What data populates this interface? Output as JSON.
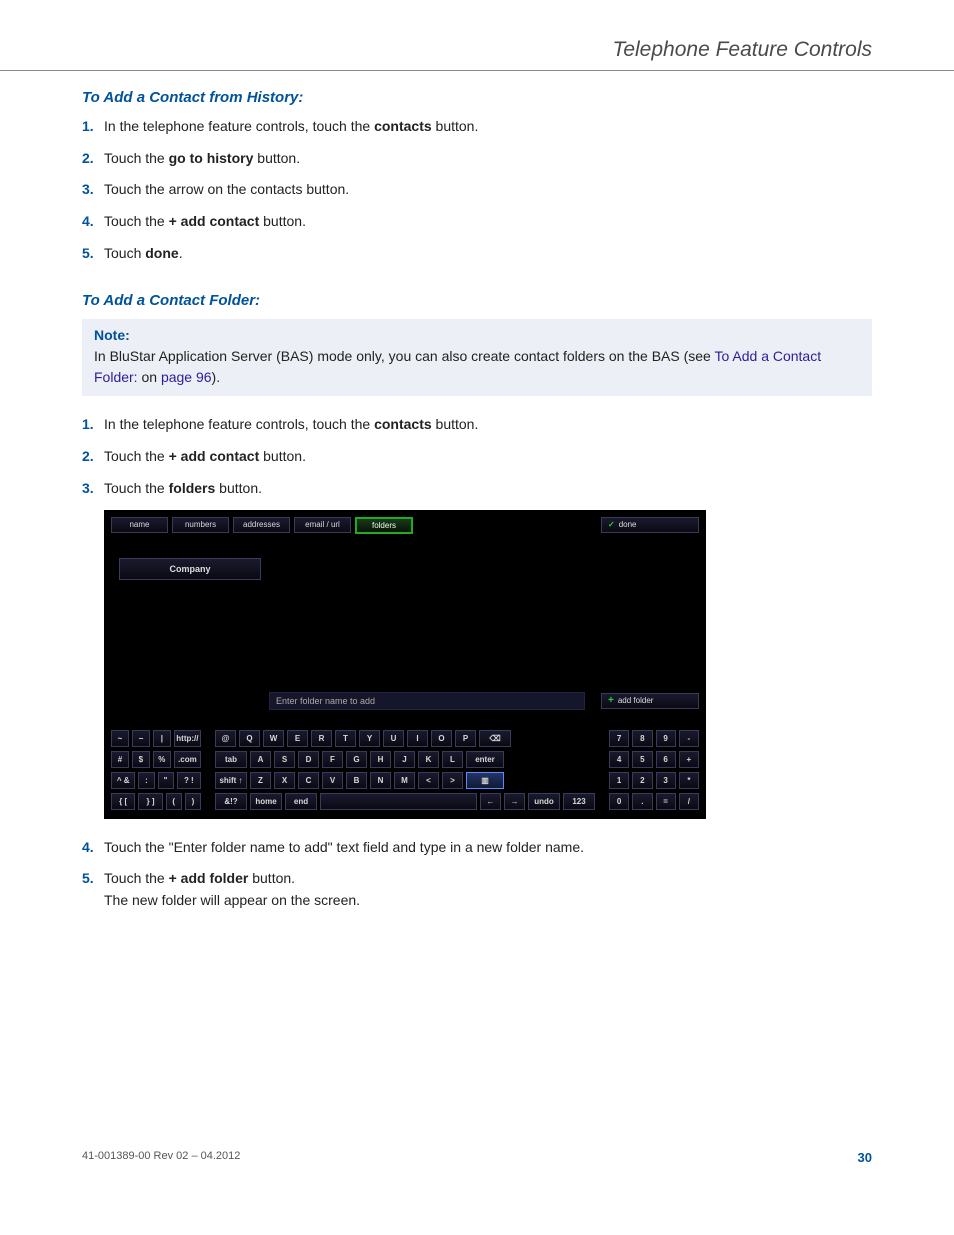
{
  "header": {
    "title": "Telephone Feature Controls"
  },
  "sections": {
    "history": {
      "heading": "To Add a Contact from History:",
      "steps": [
        {
          "pre": "In the telephone feature controls, touch the ",
          "bold": "contacts",
          "post": " button."
        },
        {
          "pre": "Touch the ",
          "bold": "go to history",
          "post": " button."
        },
        {
          "pre": "Touch the arrow on the contacts button.",
          "bold": "",
          "post": ""
        },
        {
          "pre": "Touch the ",
          "bold": "+ add contact",
          "post": " button."
        },
        {
          "pre": "Touch ",
          "bold": "done",
          "post": "."
        }
      ]
    },
    "folder": {
      "heading": "To Add a Contact Folder:",
      "note": {
        "title": "Note:",
        "body_pre": "In BluStar Application Server (BAS) mode only, you can also create contact folders on the BAS (see ",
        "link": "To Add a Contact Folder:",
        "body_mid": " on ",
        "page_ref": "page 96",
        "body_post": ")."
      },
      "steps1": [
        {
          "pre": "In the telephone feature controls, touch the ",
          "bold": "contacts",
          "post": " button."
        },
        {
          "pre": "Touch the ",
          "bold": "+ add contact",
          "post": " button."
        },
        {
          "pre": "Touch the ",
          "bold": "folders",
          "post": " button."
        }
      ],
      "steps2": [
        {
          "pre": "Touch the \"Enter folder name to add\" text field and type in a new folder name.",
          "bold": "",
          "post": ""
        },
        {
          "pre": "Touch the ",
          "bold": "+ add folder",
          "post": " button.",
          "sub": "The new folder will appear on the screen."
        }
      ]
    }
  },
  "ui": {
    "tabs": [
      "name",
      "numbers",
      "addresses",
      "email / url",
      "folders"
    ],
    "active_tab": "folders",
    "done": "done",
    "company": "Company",
    "input_placeholder": "Enter folder name to add",
    "add_folder": "add folder",
    "keyboard": {
      "left": [
        [
          "~",
          "−",
          "|",
          "http://"
        ],
        [
          "#",
          "$",
          "%",
          ".com"
        ],
        [
          "^\n&",
          ":",
          "\"",
          "?\n!"
        ],
        [
          "{\n[",
          "}\n]",
          "(",
          ")"
        ]
      ],
      "main": [
        [
          "@",
          "Q",
          "W",
          "E",
          "R",
          "T",
          "Y",
          "U",
          "I",
          "O",
          "P",
          "⌫"
        ],
        [
          "tab",
          "A",
          "S",
          "D",
          "F",
          "G",
          "H",
          "J",
          "K",
          "L",
          "enter"
        ],
        [
          "shift ↑",
          "Z",
          "X",
          "C",
          "V",
          "B",
          "N",
          "M",
          "<",
          ">",
          "␣"
        ],
        [
          "&!?",
          "home",
          "end",
          " ",
          "←",
          "→",
          "undo",
          "123"
        ]
      ],
      "num": [
        [
          "7",
          "8",
          "9",
          "-"
        ],
        [
          "4",
          "5",
          "6",
          "+"
        ],
        [
          "1",
          "2",
          "3",
          "*"
        ],
        [
          "0",
          ".",
          "=",
          "/"
        ]
      ]
    }
  },
  "footer": {
    "left": "41-001389-00 Rev 02 – 04.2012",
    "page": "30"
  }
}
